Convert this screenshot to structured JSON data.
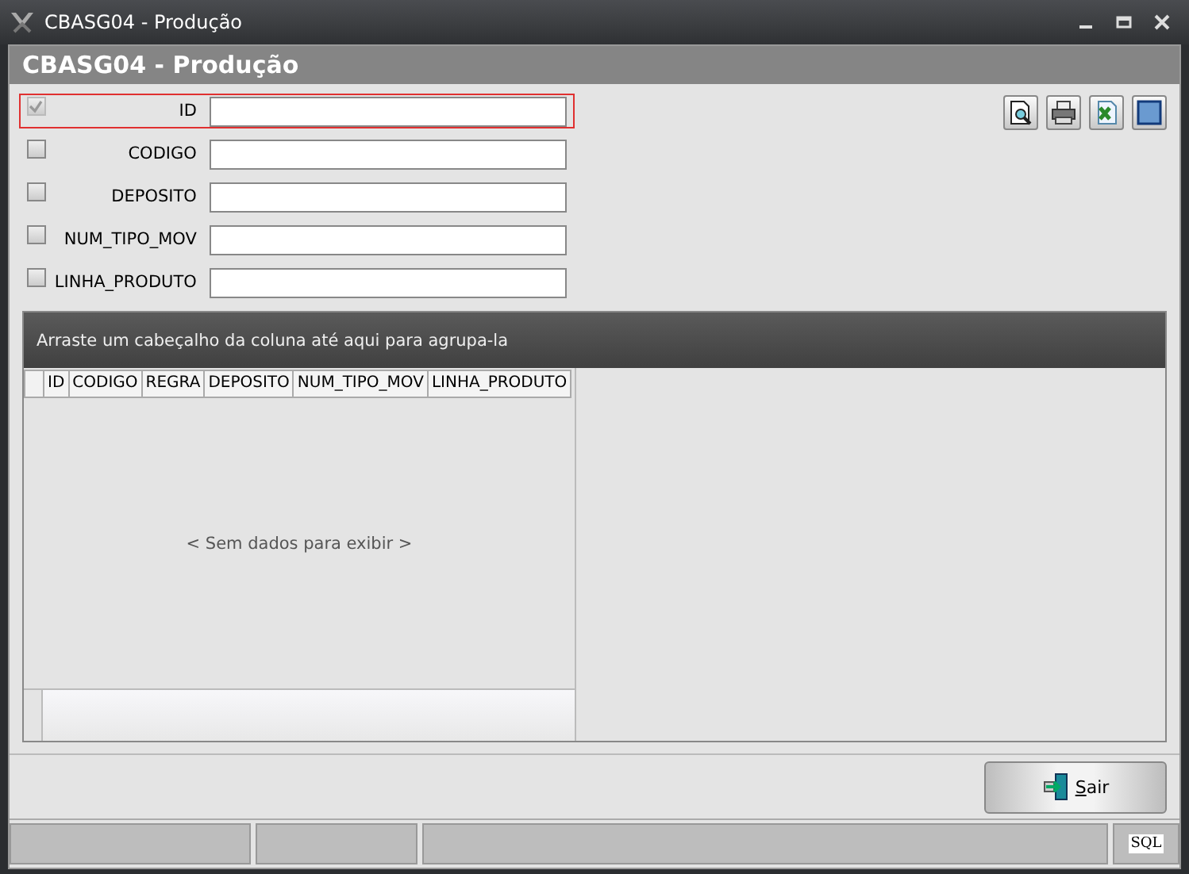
{
  "window": {
    "title": "CBASG04 - Produção"
  },
  "header": {
    "title": "CBASG04 - Produção"
  },
  "filters": [
    {
      "label": "ID",
      "checked": true,
      "disabled": true,
      "selected": true
    },
    {
      "label": "CODIGO",
      "checked": false,
      "disabled": false,
      "selected": false
    },
    {
      "label": "DEPOSITO",
      "checked": false,
      "disabled": false,
      "selected": false
    },
    {
      "label": "NUM_TIPO_MOV",
      "checked": false,
      "disabled": false,
      "selected": false
    },
    {
      "label": "LINHA_PRODUTO",
      "checked": false,
      "disabled": false,
      "selected": false
    }
  ],
  "toolbar": [
    {
      "kind": "preview"
    },
    {
      "kind": "print"
    },
    {
      "kind": "excel"
    },
    {
      "kind": "layout"
    }
  ],
  "grid": {
    "group_hint": "Arraste um cabeçalho da coluna até aqui para agrupa-la",
    "columns": [
      "ID",
      "CODIGO",
      "REGRA",
      "DEPOSITO",
      "NUM_TIPO_MOV",
      "LINHA_PRODUTO"
    ],
    "empty_text": "< Sem dados para exibir >"
  },
  "buttons": [
    {
      "label": "Sair"
    }
  ],
  "status_bar": {
    "sql": "SQL"
  }
}
